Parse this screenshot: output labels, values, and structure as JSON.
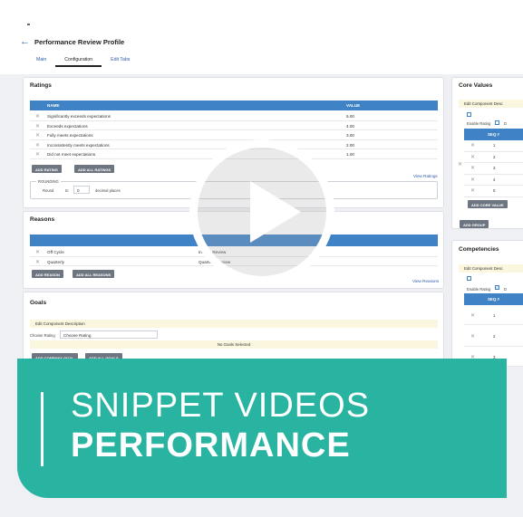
{
  "page": {
    "back_arrow": "←",
    "title": "Performance Review Profile",
    "tabs": [
      "Main",
      "Configuration",
      "Edit Tabs"
    ]
  },
  "ratings": {
    "title": "Ratings",
    "col_name": "NAME",
    "col_value": "VALUE",
    "rows": [
      {
        "name": "Significantly exceeds expectations",
        "value": "5.00"
      },
      {
        "name": "Exceeds expectations",
        "value": "4.00"
      },
      {
        "name": "Fully meets expectations",
        "value": "3.00"
      },
      {
        "name": "Inconsistently meets expectations",
        "value": "2.00"
      },
      {
        "name": "Did not meet expectations",
        "value": "1.00"
      }
    ],
    "add_rating": "ADD RATING",
    "add_all_ratings": "ADD ALL RATINGS",
    "view_link": "View Ratings",
    "rounding_label": "ROUNDING",
    "round_label": "Round",
    "to_label": "to",
    "round_value": "0",
    "decimal_label": "decimal places"
  },
  "reasons": {
    "title": "Reasons",
    "rows": [
      {
        "name": "Off Cycle",
        "value": "Interim Review"
      },
      {
        "name": "Quarterly",
        "value": "Quarterly Review"
      }
    ],
    "add_reason": "ADD REASON",
    "add_all_reasons": "ADD ALL REASONS",
    "view_link": "View Reasons"
  },
  "goals": {
    "title": "Goals",
    "edit_desc": "Edit Component Description",
    "choose_rating_label": "Choose Rating",
    "choose_rating_value": "Choose Rating",
    "no_goals": "No Goals Selected",
    "add_company_goal": "ADD COMPANY GOAL",
    "add_all_goals": "ADD ALL GOALS"
  },
  "core_values": {
    "title": "Core Values",
    "edit_desc": "Edit Component Desc",
    "enable_rating": "Enable Rating",
    "d_label": "D",
    "seq_header": "SEQ #",
    "seq": [
      "1",
      "2",
      "3",
      "4",
      "5"
    ],
    "add_core_value": "ADD CORE VALUE",
    "add_group": "ADD GROUP"
  },
  "competencies": {
    "title": "Competencies",
    "edit_desc": "Edit Component Desc",
    "enable_rating": "Enable Rating",
    "d_label": "D",
    "seq_header": "SEQ #",
    "seq": [
      "1",
      "2",
      "3"
    ]
  },
  "banner": {
    "line1": "SNIPPET VIDEOS",
    "line2": "PERFORMANCE",
    "color": "#29b4a2"
  },
  "icons": {
    "remove": "✕",
    "play": "play-icon"
  }
}
